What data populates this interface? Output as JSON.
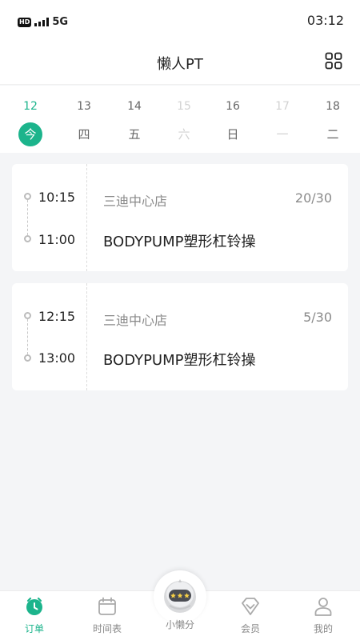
{
  "status_bar": {
    "network_badge": "HD",
    "network": "5G",
    "time": "03:12"
  },
  "nav": {
    "title": "懒人PT"
  },
  "dates": [
    {
      "num": "12",
      "day": "今",
      "state": "today"
    },
    {
      "num": "13",
      "day": "四",
      "state": "normal"
    },
    {
      "num": "14",
      "day": "五",
      "state": "normal"
    },
    {
      "num": "15",
      "day": "六",
      "state": "off"
    },
    {
      "num": "16",
      "day": "日",
      "state": "normal"
    },
    {
      "num": "17",
      "day": "一",
      "state": "off"
    },
    {
      "num": "18",
      "day": "二",
      "state": "normal"
    }
  ],
  "classes": [
    {
      "start": "10:15",
      "end": "11:00",
      "store": "三迪中心店",
      "count": "20/30",
      "course": "BODYPUMP塑形杠铃操"
    },
    {
      "start": "12:15",
      "end": "13:00",
      "store": "三迪中心店",
      "count": "5/30",
      "course": "BODYPUMP塑形杠铃操"
    }
  ],
  "tabs": [
    {
      "label": "订单",
      "icon": "clock-icon",
      "active": true
    },
    {
      "label": "时间表",
      "icon": "calendar-icon",
      "active": false
    },
    {
      "label": "小懒分",
      "icon": "robot-mascot-icon",
      "active": false
    },
    {
      "label": "会员",
      "icon": "diamond-icon",
      "active": false
    },
    {
      "label": "我的",
      "icon": "user-icon",
      "active": false
    }
  ],
  "colors": {
    "accent": "#1cb48c",
    "background": "#f4f5f7",
    "muted": "#8a8a8a"
  }
}
